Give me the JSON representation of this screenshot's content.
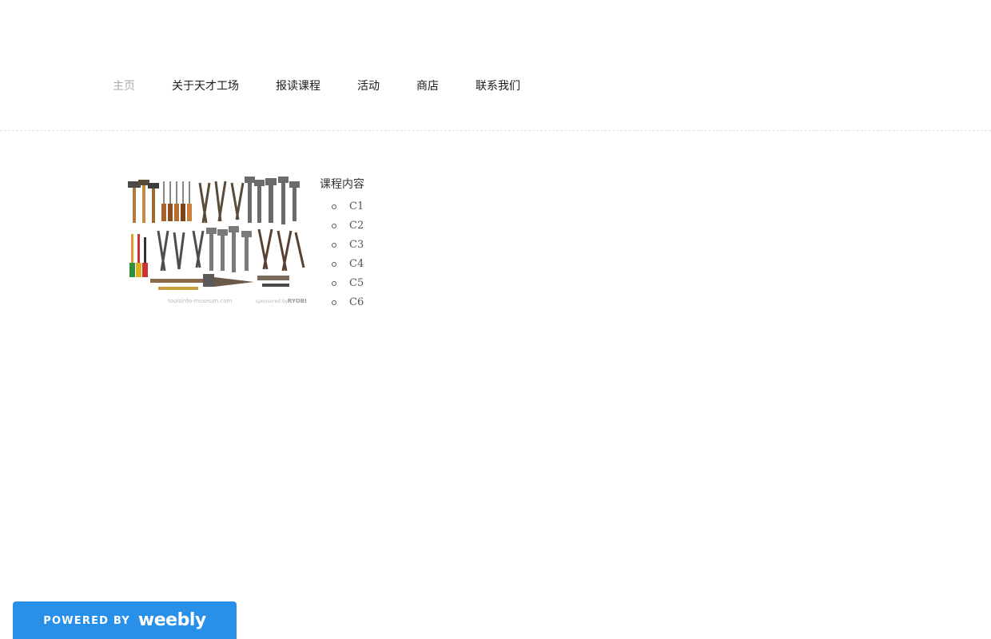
{
  "nav": {
    "items": [
      {
        "label": "主页",
        "active": true
      },
      {
        "label": "关于天才工场",
        "active": false
      },
      {
        "label": "报读课程",
        "active": false
      },
      {
        "label": "活动",
        "active": false
      },
      {
        "label": "商店",
        "active": false
      },
      {
        "label": "联系我们",
        "active": false
      }
    ]
  },
  "content": {
    "image_icon": "tools-collection-image",
    "section_title": "课程内容",
    "courses": [
      "C1",
      "C2",
      "C3",
      "C4",
      "C5",
      "C6"
    ]
  },
  "badge": {
    "powered_by": "POWERED BY",
    "brand": "weebly",
    "color": "#2990ea"
  },
  "colors": {
    "nav_active": "#a9a9a9",
    "nav_text": "#1a1a1a"
  }
}
